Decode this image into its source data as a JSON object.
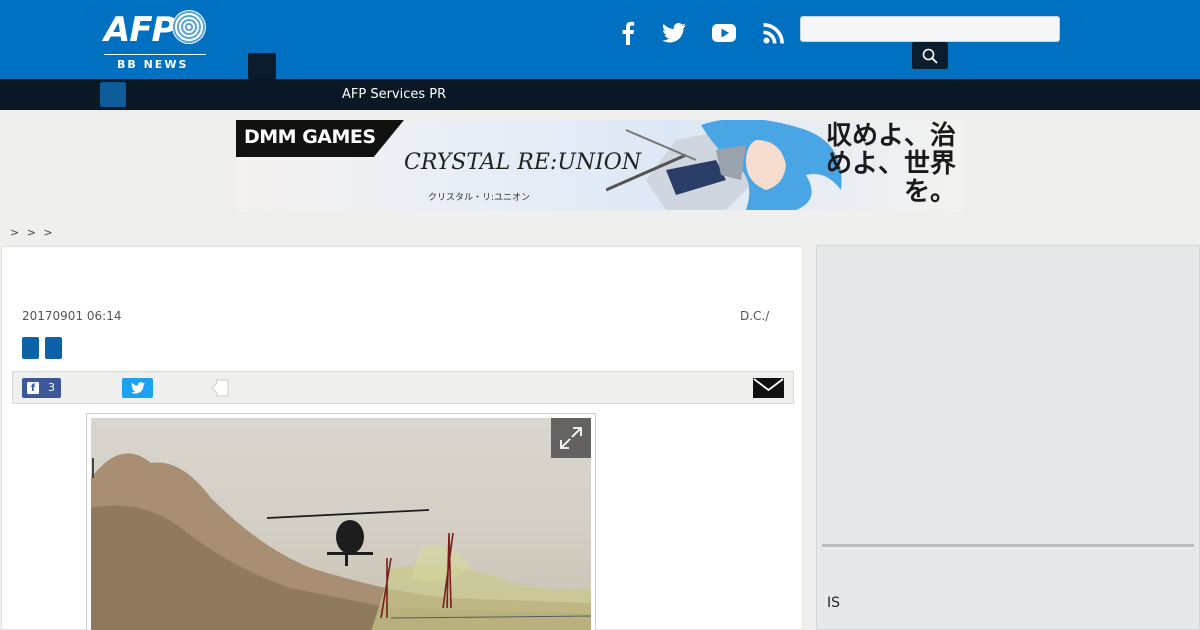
{
  "header": {
    "logo_text": "AFP",
    "logo_subtitle": "BB NEWS",
    "brand_color": "#0070c0",
    "social_icons": [
      "facebook-icon",
      "twitter-icon",
      "youtube-icon",
      "rss-icon"
    ],
    "search": {
      "placeholder": "",
      "value": ""
    }
  },
  "navbar": {
    "links": [
      {
        "label": "AFP Services PR"
      }
    ]
  },
  "banner": {
    "brand": "DMM GAMES",
    "game_title": "CRYSTAL RE:UNION",
    "game_title_kana": "クリスタル・リ:ユニオン",
    "tagline": "収めよ、治めよ、世界を。"
  },
  "breadcrumb": {
    "text": "> > >"
  },
  "article": {
    "date": "20170901 06:14",
    "dateline": "D.C./",
    "share": {
      "facebook_count": "3"
    }
  },
  "sidebar": {
    "text": "IS"
  }
}
